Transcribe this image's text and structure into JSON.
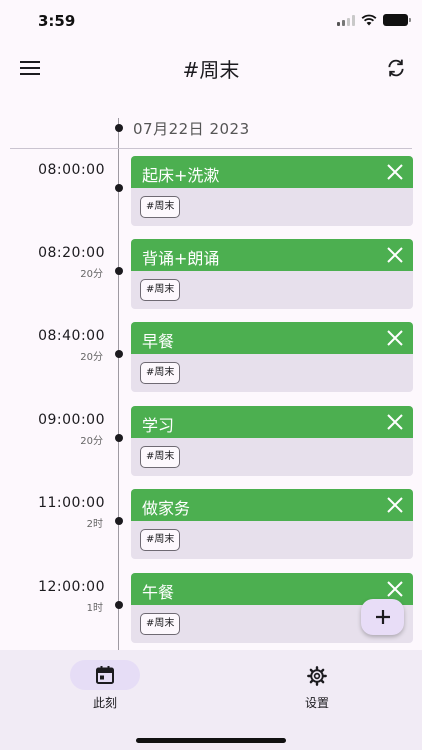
{
  "status_bar": {
    "time": "3:59"
  },
  "app_bar": {
    "title": "#周末",
    "menu_icon": "menu-icon",
    "refresh_icon": "refresh-icon"
  },
  "timeline": {
    "date": "07月22日 2023",
    "entries": [
      {
        "time": "08:00:00",
        "duration": "",
        "title": "起床+洗漱",
        "tag": "#周末"
      },
      {
        "time": "08:20:00",
        "duration": "20分",
        "title": "背诵+朗诵",
        "tag": "#周末"
      },
      {
        "time": "08:40:00",
        "duration": "20分",
        "title": "早餐",
        "tag": "#周末"
      },
      {
        "time": "09:00:00",
        "duration": "20分",
        "title": "学习",
        "tag": "#周末"
      },
      {
        "time": "11:00:00",
        "duration": "2时",
        "title": "做家务",
        "tag": "#周末"
      },
      {
        "time": "12:00:00",
        "duration": "1时",
        "title": "午餐",
        "tag": "#周末"
      }
    ]
  },
  "fab": {
    "icon": "plus-icon"
  },
  "bottom_nav": {
    "items": [
      {
        "label": "此刻",
        "icon": "calendar-icon",
        "active": true
      },
      {
        "label": "设置",
        "icon": "gear-icon",
        "active": false
      }
    ]
  },
  "colors": {
    "accent": "#4caf50",
    "surface": "#e7e0ec",
    "nav_bg": "#f1ebf5"
  }
}
